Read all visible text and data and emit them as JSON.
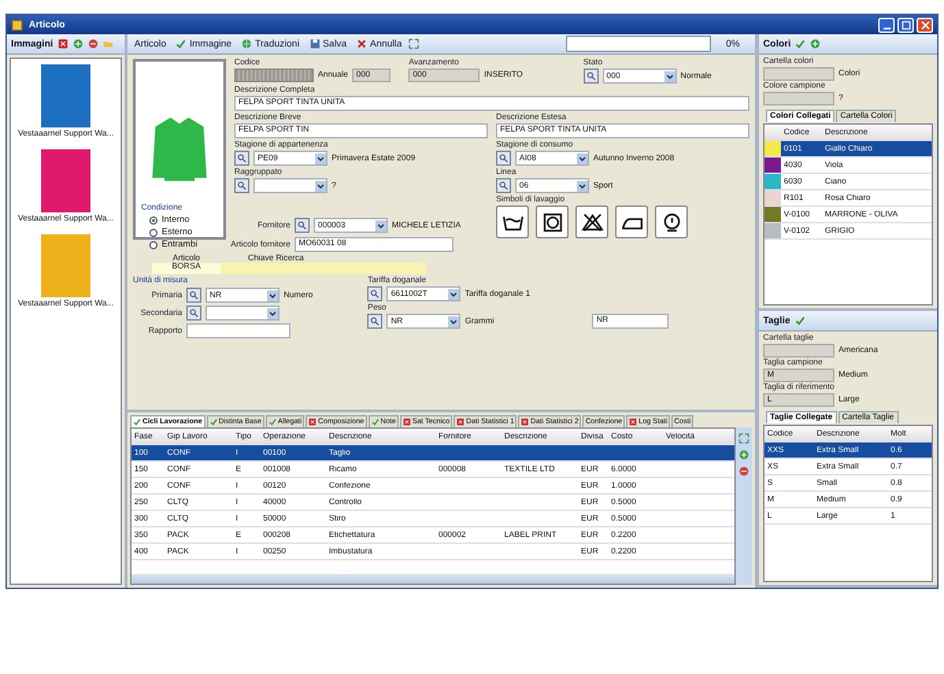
{
  "window": {
    "title": "Articolo"
  },
  "images": {
    "title": "Immagini",
    "items": [
      {
        "caption": "Vestaaarnel Support Wa...",
        "color": "#1d6fc2"
      },
      {
        "caption": "Vestaaarnel Support Wa...",
        "color": "#e0186e"
      },
      {
        "caption": "Vestaaarnel Support Wa...",
        "color": "#f0b21c"
      }
    ]
  },
  "toolbar": {
    "items": [
      {
        "label": "Articolo",
        "kind": "plain"
      },
      {
        "label": "Immagine",
        "kind": "check"
      },
      {
        "label": "Traduzioni",
        "kind": "translate"
      },
      {
        "label": "Salva",
        "kind": "save"
      },
      {
        "label": "Annulla",
        "kind": "cancel"
      }
    ],
    "progress": "0%"
  },
  "preview": {
    "color": "#2fb84a"
  },
  "form": {
    "rows": [
      [
        {
          "label": "Codice",
          "kind": "masked",
          "suffix_label": "Annuale",
          "suffix_value": "000"
        },
        {
          "label": "Avanzamento",
          "kind": "readonly",
          "value": "000",
          "note": "INSERITO"
        },
        {
          "label": "Stato",
          "kind": "lookup",
          "value": "000",
          "note": "Normale"
        }
      ],
      [
        {
          "label": "Descrizione Completa",
          "kind": "text",
          "value": "FELPA SPORT TINTA UNITA"
        }
      ],
      [
        {
          "label": "Descrizione Breve",
          "kind": "text",
          "value": "FELPA SPORT TIN"
        },
        {
          "label": "Descrizione Estesa",
          "kind": "text",
          "value": "FELPA SPORT TINTA UNITA"
        }
      ],
      [
        {
          "label": "Stagione di appartenenza",
          "kind": "lookup",
          "value": "PE09",
          "note": "Primavera Estate 2009"
        },
        {
          "label": "Stagione di consumo",
          "kind": "lookup",
          "value": "AI08",
          "note": "Autunno Inverno 2008"
        }
      ],
      [
        {
          "label": "Raggruppato",
          "kind": "lookup",
          "note": "?"
        },
        {
          "label": "Linea",
          "kind": "lookup",
          "value": "06",
          "note": "Sport"
        }
      ]
    ],
    "symbols": {
      "label": "Simboli di lavaggio",
      "items": [
        {
          "kind": "wash"
        },
        {
          "kind": "tumble"
        },
        {
          "kind": "no-bleach"
        },
        {
          "kind": "iron"
        },
        {
          "kind": "dry-clean"
        }
      ]
    },
    "condition": {
      "label": "Condizione",
      "options": [
        {
          "label": "Interno",
          "selected": true
        },
        {
          "label": "Esterno",
          "selected": false
        },
        {
          "label": "Entrambi",
          "selected": false
        }
      ]
    },
    "supplier": {
      "label": "Fornitore",
      "value": "000003",
      "note": "MICHELE LETIZIA"
    },
    "supplier_item": {
      "label": "Articolo fornitore",
      "value": "MO60031 08"
    },
    "search_key": {
      "columns": [
        "Articolo",
        "Chiave Ricerca"
      ],
      "value": "BORSA"
    },
    "units": {
      "label": "Unità di misura",
      "primary": {
        "label": "Primaria",
        "value": "NR",
        "note": "Numero"
      },
      "secondary": {
        "label": "Secondaria"
      },
      "ratio": {
        "label": "Rapporto"
      }
    },
    "customs": {
      "label": "Tariffa doganale",
      "value": "6611002T",
      "note": "Tariffa doganale 1"
    },
    "weight": {
      "label": "Peso",
      "value": "NR",
      "note": "Grammi",
      "extra": "NR"
    }
  },
  "cycles": {
    "tabs": [
      {
        "label": "Cicli Lavorazione",
        "kind": "ok",
        "selected": true
      },
      {
        "label": "Distinta Base",
        "kind": "ok",
        "selected": false
      },
      {
        "label": "Allegati",
        "kind": "ok",
        "selected": false
      },
      {
        "label": "Composizione",
        "kind": "error",
        "selected": false
      },
      {
        "label": "Note",
        "kind": "ok",
        "selected": false
      },
      {
        "label": "Sat Tecnico",
        "kind": "error",
        "selected": false
      },
      {
        "label": "Dati Statistici 1",
        "kind": "error",
        "selected": false
      },
      {
        "label": "Dati Statistici 2",
        "kind": "error",
        "selected": false
      },
      {
        "label": "Confezione",
        "kind": "plain",
        "selected": false
      },
      {
        "label": "Log Stati",
        "kind": "error",
        "selected": false
      },
      {
        "label": "Costi",
        "kind": "plain",
        "selected": false
      }
    ],
    "columns": [
      "Fase",
      "Gip Lavoro",
      "Tipo",
      "Operazione",
      "Descrizione",
      "Fornitore",
      "Descrizione",
      "Divisa",
      "Costo",
      "Velocità"
    ],
    "rows": [
      {
        "selected": true,
        "cells": [
          "100",
          "CONF",
          "I",
          "00100",
          "Taglio",
          "",
          "",
          "",
          "",
          ""
        ]
      },
      {
        "selected": false,
        "cells": [
          "150",
          "CONF",
          "E",
          "001008",
          "Ricamo",
          "000008",
          "TEXTILE LTD",
          "EUR",
          "6.0000",
          ""
        ]
      },
      {
        "selected": false,
        "cells": [
          "200",
          "CONF",
          "I",
          "00120",
          "Confezione",
          "",
          "",
          "EUR",
          "1.0000",
          ""
        ]
      },
      {
        "selected": false,
        "cells": [
          "250",
          "CLTQ",
          "I",
          "40000",
          "Controllo",
          "",
          "",
          "EUR",
          "0.5000",
          ""
        ]
      },
      {
        "selected": false,
        "cells": [
          "300",
          "CLTQ",
          "I",
          "50000",
          "Stiro",
          "",
          "",
          "EUR",
          "0.5000",
          ""
        ]
      },
      {
        "selected": false,
        "cells": [
          "350",
          "PACK",
          "E",
          "000208",
          "Etichettatura",
          "000002",
          "LABEL PRINT",
          "EUR",
          "0.2200",
          ""
        ]
      },
      {
        "selected": false,
        "cells": [
          "400",
          "PACK",
          "I",
          "00250",
          "Imbustatura",
          "",
          "",
          "EUR",
          "0.2200",
          ""
        ]
      }
    ]
  },
  "colors": {
    "title": "Colori",
    "folder": {
      "label": "Cartella colori",
      "note": "Colori"
    },
    "sample": {
      "label": "Colore campione",
      "note": "?"
    },
    "tabs": [
      {
        "label": "Colori Collegati",
        "selected": true
      },
      {
        "label": "Cartella Colori",
        "selected": false
      }
    ],
    "columns": [
      "Codice",
      "Descrizione"
    ],
    "rows": [
      {
        "color": "#f2ea4a",
        "code": "0101",
        "desc": "Giallo Chiaro",
        "selected": true
      },
      {
        "color": "#7a1a8e",
        "code": "4030",
        "desc": "Viola",
        "selected": false
      },
      {
        "color": "#28b8c8",
        "code": "6030",
        "desc": "Ciano",
        "selected": false
      },
      {
        "color": "#ecd4d0",
        "code": "R101",
        "desc": "Rosa Chiaro",
        "selected": false
      },
      {
        "color": "#727a24",
        "code": "V-0100",
        "desc": "MARRONE - OLIVA",
        "selected": false
      },
      {
        "color": "#b8bcc0",
        "code": "V-0102",
        "desc": "GRIGIO",
        "selected": false
      }
    ]
  },
  "sizes": {
    "title": "Taglie",
    "folder": {
      "label": "Cartella taglie",
      "note": "Americana"
    },
    "sample": {
      "label": "Taglia campione",
      "value": "M",
      "note": "Medium"
    },
    "reference": {
      "label": "Taglia di riferimento",
      "value": "L",
      "note": "Large"
    },
    "tabs": [
      {
        "label": "Taglie Collegate",
        "selected": true
      },
      {
        "label": "Cartella Taglie",
        "selected": false
      }
    ],
    "columns": [
      "Codice",
      "Descrizione",
      "Molt"
    ],
    "rows": [
      {
        "selected": true,
        "cells": [
          "XXS",
          "Extra Small",
          "0.6"
        ]
      },
      {
        "selected": false,
        "cells": [
          "XS",
          "Extra Small",
          "0.7"
        ]
      },
      {
        "selected": false,
        "cells": [
          "S",
          "Small",
          "0.8"
        ]
      },
      {
        "selected": false,
        "cells": [
          "M",
          "Medium",
          "0.9"
        ]
      },
      {
        "selected": false,
        "cells": [
          "L",
          "Large",
          "1"
        ]
      }
    ]
  }
}
